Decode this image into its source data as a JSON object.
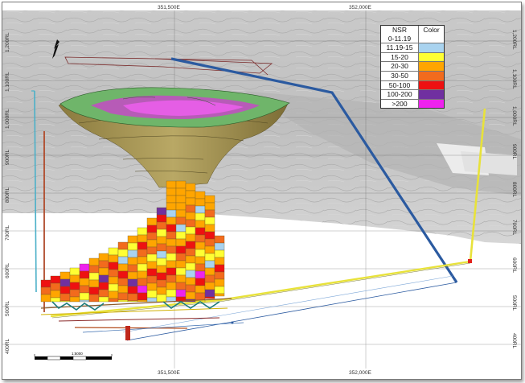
{
  "easting_labels": {
    "top": [
      "351,500E",
      "352,000E"
    ],
    "bottom": [
      "351,500E",
      "352,000E"
    ]
  },
  "rl_labels": [
    "1,200RL",
    "1,100RL",
    "1,000RL",
    "900RL",
    "800RL",
    "700RL",
    "600RL",
    "500RL",
    "400RL"
  ],
  "legend": {
    "header_nsr": "NSR",
    "header_color": "Color",
    "items": [
      {
        "range": "0-11.19",
        "color": "#ffffff"
      },
      {
        "range": "11.19-15",
        "color": "#a9d3ef"
      },
      {
        "range": "15-20",
        "color": "#ffff33"
      },
      {
        "range": "20-30",
        "color": "#ffa500"
      },
      {
        "range": "30-50",
        "color": "#f26b1d"
      },
      {
        "range": "50-100",
        "color": "#ee1111"
      },
      {
        "range": "100-200",
        "color": "#7030a0"
      },
      {
        "range": ">200",
        "color": "#ee22ee"
      }
    ]
  },
  "scale_label": "1:5000",
  "colors": {
    "pit_shell": "#9a8a4c",
    "pit_top_green": "#6fb56a",
    "decline_blue": "#2b5aa0",
    "yellow_drive": "#f0ec3c",
    "shaft_red": "#b04a2a",
    "shaft_cyan": "#4bb0c8"
  }
}
